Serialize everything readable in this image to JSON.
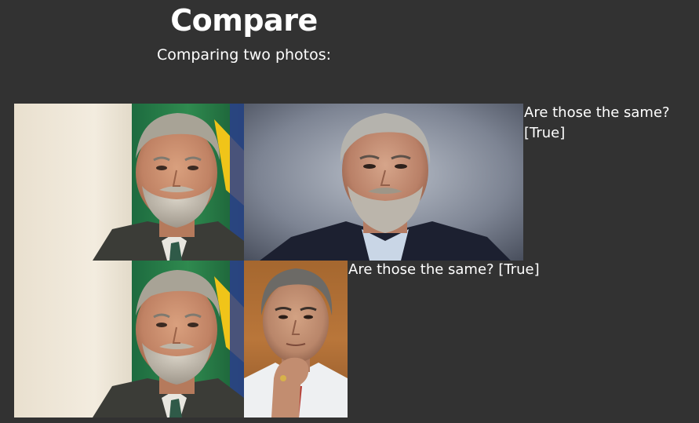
{
  "header": {
    "title": "Compare",
    "subtitle": "Comparing two photos:"
  },
  "comparisons": [
    {
      "result_text": "Are those the same? [True]"
    },
    {
      "result_text": "Are those the same? [True]"
    }
  ]
}
